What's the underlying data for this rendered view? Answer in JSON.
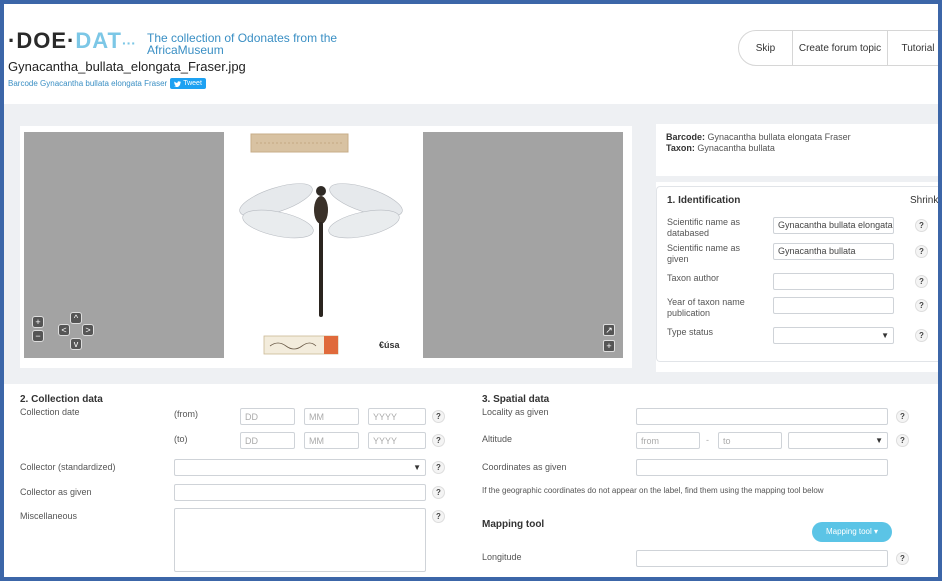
{
  "header": {
    "logo": {
      "dot": "·",
      "doe": "DOE",
      "sep": "·",
      "dat": "DAT",
      "dots": "···"
    },
    "subtitle": "The collection of Odonates from the AfricaMuseum",
    "filename": "Gynacantha_bullata_elongata_Fraser.jpg",
    "barcode_line": "Barcode Gynacantha bullata elongata Fraser",
    "tweet_label": "Tweet",
    "buttons": {
      "skip": "Skip",
      "forum": "Create forum topic",
      "tutorial": "Tutorial"
    }
  },
  "viewer": {
    "controls": {
      "zoom_in": "+",
      "zoom_out": "−",
      "pan_up": "^",
      "pan_left": "<",
      "pan_right": ">",
      "pan_down": "v",
      "rotate": "↗",
      "reset": "+"
    },
    "sticker": "€úsa"
  },
  "meta": {
    "barcode_label": "Barcode:",
    "barcode_value": "Gynacantha bullata elongata Fraser",
    "taxon_label": "Taxon:",
    "taxon_value": "Gynacantha bullata"
  },
  "identification": {
    "title": "1. Identification",
    "shrink": "Shrink",
    "fields": [
      {
        "label": "Scientific name as databased",
        "value": "Gynacantha bullata elongata Fra"
      },
      {
        "label": "Scientific name as given",
        "value": "Gynacantha bullata"
      },
      {
        "label": "Taxon author",
        "value": ""
      },
      {
        "label": "Year of taxon name publication",
        "value": ""
      },
      {
        "label": "Type status",
        "value": ""
      }
    ],
    "help": "?"
  },
  "collection": {
    "title": "2. Collection data",
    "date_label": "Collection date",
    "from": "(from)",
    "to": "(to)",
    "dd": "DD",
    "mm": "MM",
    "yyyy": "YYYY",
    "collector_std": "Collector (standardized)",
    "collector_given": "Collector as given",
    "misc": "Miscellaneous"
  },
  "spatial": {
    "title": "3. Spatial data",
    "locality": "Locality as given",
    "altitude": "Altitude",
    "alt_from": "from",
    "alt_sep": "-",
    "alt_to": "to",
    "coords": "Coordinates as given",
    "note": "If the geographic coordinates do not appear on the label, find them using the mapping tool below",
    "mapping_title": "Mapping tool",
    "mapping_button": "Mapping tool ▾",
    "longitude": "Longitude"
  }
}
